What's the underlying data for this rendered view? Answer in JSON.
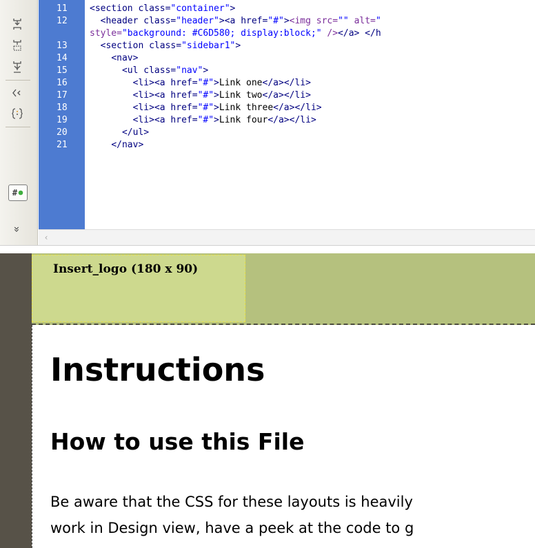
{
  "code_view": {
    "line_numbers": [
      "11",
      "12",
      "13",
      "14",
      "15",
      "16",
      "17",
      "18",
      "19",
      "20",
      "21"
    ],
    "lines": [
      {
        "indent": "",
        "segments": [
          [
            "tag",
            "<section "
          ],
          [
            "attr",
            "class="
          ],
          [
            "str",
            "\"container\""
          ],
          [
            "tag",
            ">"
          ]
        ]
      },
      {
        "indent": "  ",
        "segments": [
          [
            "tag",
            "<header "
          ],
          [
            "attr",
            "class="
          ],
          [
            "str",
            "\"header\""
          ],
          [
            "tag",
            ">"
          ],
          [
            "tag",
            "<a "
          ],
          [
            "attr",
            "href="
          ],
          [
            "str",
            "\"#\""
          ],
          [
            "tag",
            ">"
          ],
          [
            "kw",
            "<img "
          ],
          [
            "kw",
            "src="
          ],
          [
            "str",
            "\"\""
          ],
          [
            "kw",
            " alt="
          ],
          [
            "str",
            "\""
          ]
        ]
      },
      {
        "indent": "",
        "segments": [
          [
            "kw",
            "style="
          ],
          [
            "str",
            "\"background: #C6D580; display:block;\""
          ],
          [
            "kw",
            " />"
          ],
          [
            "tag",
            "</a>"
          ],
          [
            "tag",
            " </h"
          ]
        ]
      },
      {
        "indent": "  ",
        "segments": [
          [
            "tag",
            "<section "
          ],
          [
            "attr",
            "class="
          ],
          [
            "str",
            "\"sidebar1\""
          ],
          [
            "tag",
            ">"
          ]
        ]
      },
      {
        "indent": "    ",
        "segments": [
          [
            "tag",
            "<nav>"
          ]
        ]
      },
      {
        "indent": "      ",
        "segments": [
          [
            "tag",
            "<ul "
          ],
          [
            "attr",
            "class="
          ],
          [
            "str",
            "\"nav\""
          ],
          [
            "tag",
            ">"
          ]
        ]
      },
      {
        "indent": "        ",
        "segments": [
          [
            "tag",
            "<li>"
          ],
          [
            "tag",
            "<a "
          ],
          [
            "attr",
            "href="
          ],
          [
            "str",
            "\"#\""
          ],
          [
            "tag",
            ">"
          ],
          [
            "txt",
            "Link one"
          ],
          [
            "tag",
            "</a>"
          ],
          [
            "tag",
            "</li>"
          ]
        ]
      },
      {
        "indent": "        ",
        "segments": [
          [
            "tag",
            "<li>"
          ],
          [
            "tag",
            "<a "
          ],
          [
            "attr",
            "href="
          ],
          [
            "str",
            "\"#\""
          ],
          [
            "tag",
            ">"
          ],
          [
            "txt",
            "Link two"
          ],
          [
            "tag",
            "</a>"
          ],
          [
            "tag",
            "</li>"
          ]
        ]
      },
      {
        "indent": "        ",
        "segments": [
          [
            "tag",
            "<li>"
          ],
          [
            "tag",
            "<a "
          ],
          [
            "attr",
            "href="
          ],
          [
            "str",
            "\"#\""
          ],
          [
            "tag",
            ">"
          ],
          [
            "txt",
            "Link three"
          ],
          [
            "tag",
            "</a>"
          ],
          [
            "tag",
            "</li>"
          ]
        ]
      },
      {
        "indent": "        ",
        "segments": [
          [
            "tag",
            "<li>"
          ],
          [
            "tag",
            "<a "
          ],
          [
            "attr",
            "href="
          ],
          [
            "str",
            "\"#\""
          ],
          [
            "tag",
            ">"
          ],
          [
            "txt",
            "Link four"
          ],
          [
            "tag",
            "</a>"
          ],
          [
            "tag",
            "</li>"
          ]
        ]
      },
      {
        "indent": "      ",
        "segments": [
          [
            "tag",
            "</ul>"
          ]
        ]
      },
      {
        "indent": "    ",
        "segments": [
          [
            "tag",
            "</nav>"
          ]
        ]
      }
    ],
    "colors": {
      "gutter": "#4d7bd1",
      "tag": "#000080",
      "string": "#0000ff",
      "img_tag": "#7a2d9a"
    }
  },
  "toolbar": {
    "icons": [
      {
        "name": "expand-all-icon"
      },
      {
        "name": "select-parent-tag-icon"
      },
      {
        "name": "collapse-selection-icon"
      },
      {
        "name": "highlight-invalid-code-icon"
      },
      {
        "name": "apply-comment-icon"
      },
      {
        "name": "live-code-hash-icon",
        "glyph": "#"
      },
      {
        "name": "more-tools-chevron-icon",
        "glyph": "»"
      }
    ]
  },
  "design_view": {
    "logo_placeholder": "Insert_logo (180 x 90)",
    "heading1": "Instructions",
    "heading2": "How to use this File",
    "paragraph_lines": [
      "Be aware that the CSS for these layouts is heavily",
      "work in Design view, have a peek at the code to g"
    ],
    "colors": {
      "header_bg": "#b5c17e",
      "logo_bg": "#cdd98e",
      "left_edge": "#575248"
    }
  }
}
